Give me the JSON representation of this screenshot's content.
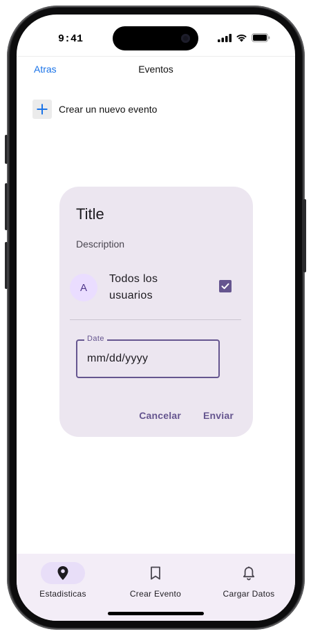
{
  "status_bar": {
    "time": "9:41"
  },
  "header": {
    "back_label": "Atras",
    "title": "Eventos"
  },
  "create_row": {
    "label": "Crear un nuevo evento"
  },
  "dialog": {
    "title": "Title",
    "description": "Description",
    "list_item": {
      "avatar_letter": "A",
      "label": "Todos los usuarios",
      "checked": true
    },
    "date_field": {
      "label": "Date",
      "placeholder": "mm/dd/yyyy"
    },
    "cancel_label": "Cancelar",
    "submit_label": "Enviar"
  },
  "bottom_nav": {
    "items": [
      {
        "label": "Estadisticas",
        "icon": "location-pin-icon",
        "active": true
      },
      {
        "label": "Crear Evento",
        "icon": "bookmark-icon",
        "active": false
      },
      {
        "label": "Cargar Datos",
        "icon": "bell-icon",
        "active": false
      }
    ]
  },
  "colors": {
    "accent": "#65558f",
    "link": "#1a73e8",
    "dialog_bg": "#ece6f0",
    "nav_bg": "#f3edf7",
    "active_pill": "#e8def8"
  }
}
